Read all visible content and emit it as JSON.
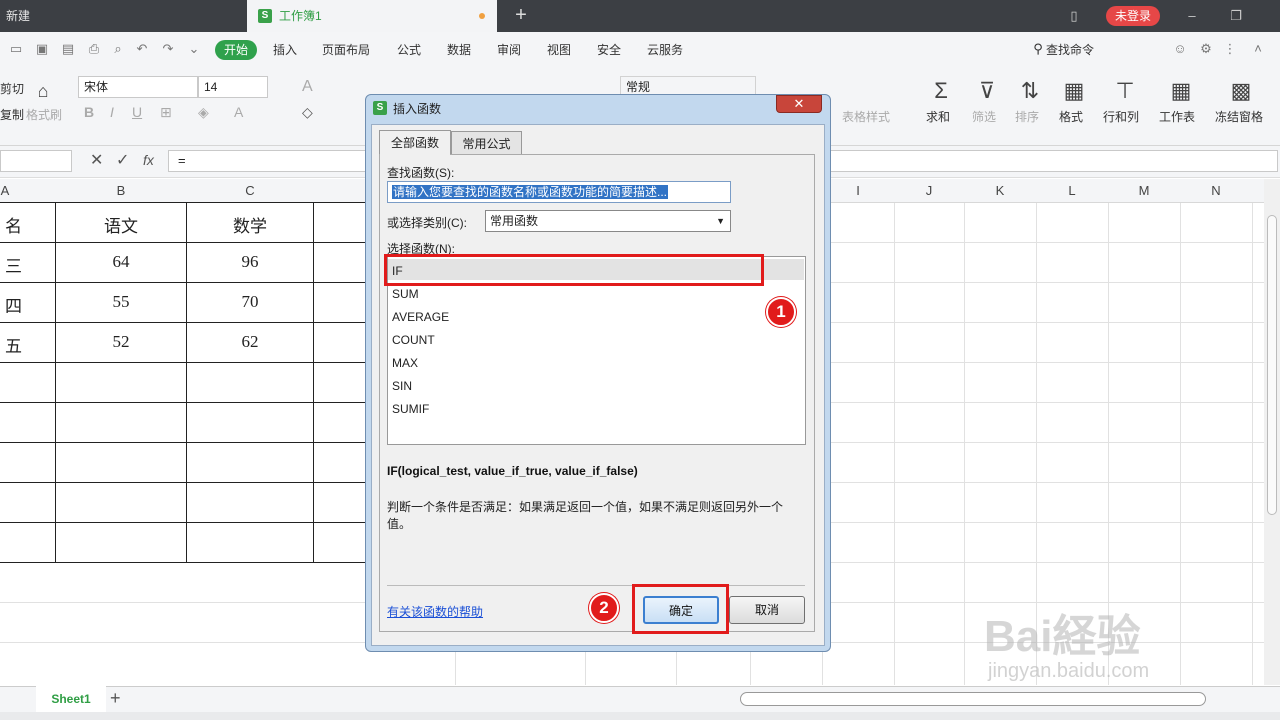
{
  "titlebar": {
    "new_tab": "新建",
    "doc_tab": "工作簿1",
    "login_label": "未登录"
  },
  "menubar": {
    "start": "开始",
    "items": [
      "插入",
      "页面布局",
      "公式",
      "数据",
      "审阅",
      "视图",
      "安全",
      "云服务"
    ],
    "search": "查找命令"
  },
  "ribbon": {
    "cut": "剪切",
    "copy": "复制",
    "format_painter": "格式刷",
    "font_name": "宋体",
    "font_size": "14",
    "number_format": "常规",
    "table_style": "表格样式",
    "sum": "求和",
    "filter": "筛选",
    "sort": "排序",
    "format": "格式",
    "row_col": "行和列",
    "worksheet": "工作表",
    "freeze": "冻结窗格"
  },
  "formula_bar": {
    "fx": "fx",
    "value": "="
  },
  "columns": [
    "A",
    "B",
    "C",
    "I",
    "J",
    "K",
    "L",
    "M",
    "N"
  ],
  "table": {
    "header": [
      "名",
      "语文",
      "数学"
    ],
    "rows": [
      [
        "三",
        "64",
        "96"
      ],
      [
        "四",
        "55",
        "70"
      ],
      [
        "五",
        "52",
        "62"
      ]
    ]
  },
  "sheet": {
    "tab": "Sheet1",
    "add": "+"
  },
  "dialog": {
    "title": "插入函数",
    "tabs": [
      "全部函数",
      "常用公式"
    ],
    "search_label": "查找函数(S):",
    "search_placeholder": "请输入您要查找的函数名称或函数功能的简要描述...",
    "category_label": "或选择类别(C):",
    "category_value": "常用函数",
    "select_label": "选择函数(N):",
    "functions": [
      "IF",
      "SUM",
      "AVERAGE",
      "COUNT",
      "MAX",
      "SIN",
      "SUMIF"
    ],
    "selected_function": "IF",
    "signature": "IF(logical_test, value_if_true, value_if_false)",
    "description": "判断一个条件是否满足：如果满足返回一个值，如果不满足则返回另外一个值。",
    "help_link": "有关该函数的帮助",
    "ok": "确定",
    "cancel": "取消"
  },
  "annotations": {
    "step1": "1",
    "step2": "2"
  },
  "watermark": {
    "text": "Bai経验",
    "url": "jingyan.baidu.com"
  },
  "colors": {
    "accent_green": "#2fa14c",
    "annotation_red": "#e11b1b",
    "titlebar": "#3c3f44"
  }
}
